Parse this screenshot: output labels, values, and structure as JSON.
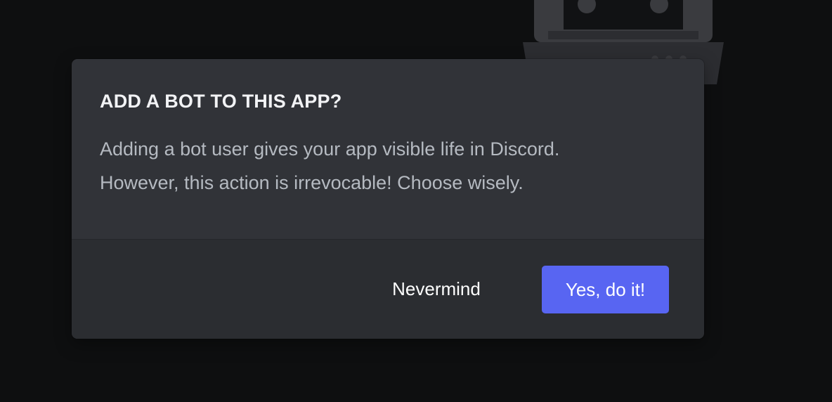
{
  "background": {
    "illustration_icon": "robot-icon"
  },
  "modal": {
    "title": "ADD A BOT TO THIS APP?",
    "body_line_1": "Adding a bot user gives your app visible life in Discord.",
    "body_line_2": "However, this action is irrevocable! Choose wisely.",
    "cancel_label": "Nevermind",
    "confirm_label": "Yes, do it!"
  },
  "colors": {
    "page_background": "#0e0f10",
    "modal_background": "#313338",
    "footer_background": "#2b2d31",
    "title_text": "#f2f3f5",
    "body_text": "#b5bac1",
    "primary_button": "#5865f2"
  }
}
